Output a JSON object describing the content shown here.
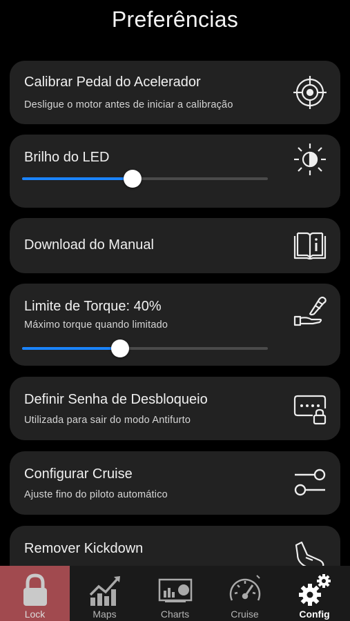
{
  "header": {
    "title": "Preferências"
  },
  "cards": {
    "calibrate": {
      "title": "Calibrar Pedal do Acelerador",
      "subtitle": "Desligue o motor antes de iniciar a calibração",
      "icon": "crosshair-icon"
    },
    "led": {
      "title": "Brilho do LED",
      "icon": "brightness-icon",
      "level": 0.45
    },
    "manual": {
      "title": "Download do Manual",
      "icon": "book-info-icon"
    },
    "torque": {
      "title": "Limite de Torque: 40%",
      "subtitle": "Máximo torque quando limitado",
      "icon": "foot-pedal-icon",
      "level": 0.4
    },
    "password": {
      "title": "Definir Senha de Desbloqueio",
      "subtitle": "Utilizada para sair do modo Antifurto",
      "icon": "password-lock-icon"
    },
    "cruise": {
      "title": "Configurar Cruise",
      "subtitle": "Ajuste fino do piloto automático",
      "icon": "sliders-icon"
    },
    "kickdown": {
      "title": "Remover Kickdown",
      "icon": "foot-icon"
    }
  },
  "tabbar": {
    "tabs": [
      {
        "label": "Lock",
        "icon": "lock-icon"
      },
      {
        "label": "Maps",
        "icon": "trend-chart-icon"
      },
      {
        "label": "Charts",
        "icon": "dashboard-chart-icon"
      },
      {
        "label": "Cruise",
        "icon": "speedometer-icon"
      },
      {
        "label": "Config",
        "icon": "gears-icon"
      }
    ],
    "selected": "Config"
  },
  "colors": {
    "accent": "#1a84ff",
    "card": "#222222",
    "lock_tab": "#a14a4f"
  }
}
